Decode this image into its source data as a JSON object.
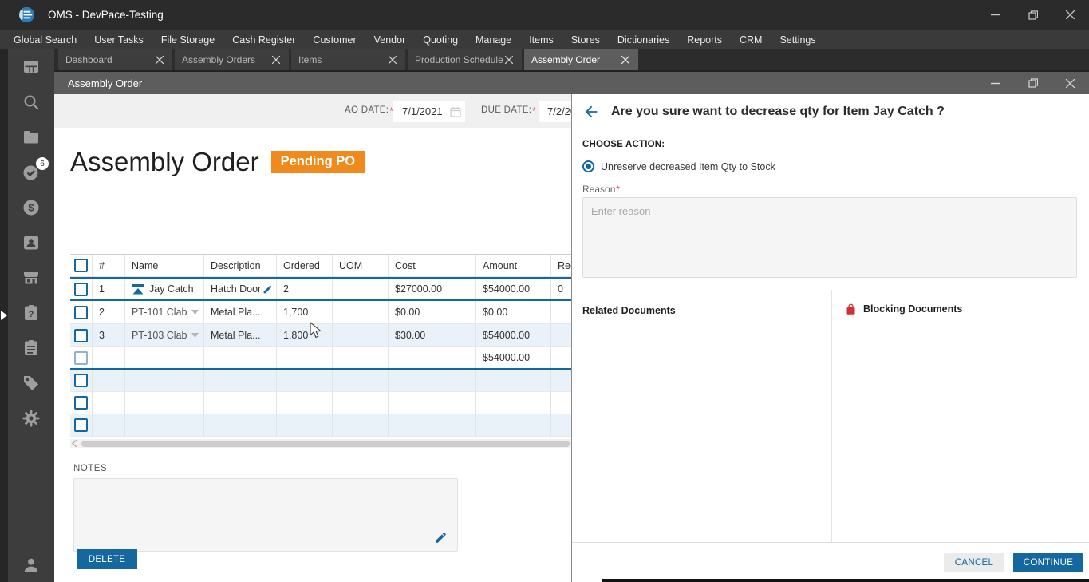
{
  "app": {
    "title": "OMS - DevPace-Testing"
  },
  "menu": {
    "items": [
      "Global Search",
      "User Tasks",
      "File Storage",
      "Cash Register",
      "Customer",
      "Vendor",
      "Quoting",
      "Manage",
      "Items",
      "Stores",
      "Dictionaries",
      "Reports",
      "CRM",
      "Settings"
    ]
  },
  "tabs": [
    {
      "label": "Dashboard"
    },
    {
      "label": "Assembly Orders"
    },
    {
      "label": "Items"
    },
    {
      "label": "Production Schedule"
    },
    {
      "label": "Assembly Order"
    }
  ],
  "sidebar": {
    "task_badge_count": "6"
  },
  "ao_window": {
    "window_title": "Assembly Order",
    "ao_date_label": "AO DATE:",
    "ao_date_value": "7/1/2021",
    "due_date_label": "DUE DATE:",
    "due_date_value": "7/2/20",
    "required_mark": "*",
    "heading": "Assembly Order",
    "status_badge": "Pending PO",
    "table": {
      "headers": {
        "num": "#",
        "name": "Name",
        "description": "Description",
        "ordered": "Ordered",
        "uom": "UOM",
        "cost": "Cost",
        "amount": "Amount",
        "received": "Rec"
      },
      "rows": [
        {
          "num": "1",
          "name": "Jay Catch",
          "description": "Hatch Door",
          "ordered": "2",
          "uom": "",
          "cost": "$27000.00",
          "amount": "$54000.00",
          "received": "0"
        },
        {
          "num": "2",
          "name": "PT-101 Clab",
          "description": "Metal Pla...",
          "ordered": "1,700",
          "uom": "",
          "cost": "$0.00",
          "amount": "$0.00",
          "received": ""
        },
        {
          "num": "3",
          "name": "PT-103 Clab",
          "description": "Metal Pla...",
          "ordered": "1,800",
          "uom": "",
          "cost": "$30.00",
          "amount": "$54000.00",
          "received": ""
        }
      ],
      "total_amount": "$54000.00"
    },
    "notes_label": "NOTES",
    "delete_button_label": "DELETE"
  },
  "dialog": {
    "title": "Are you sure want to decrease qty for Item Jay Catch ?",
    "choose_action_label": "CHOOSE ACTION:",
    "action_option": "Unreserve decreased Item Qty to Stock",
    "reason_label": "Reason",
    "required_mark": "*",
    "reason_placeholder": "Enter reason",
    "related_documents_title": "Related Documents",
    "blocking_documents_title": "Blocking Documents",
    "cancel_button_label": "CANCEL",
    "continue_button_label": "CONTINUE"
  },
  "colors": {
    "accent_blue": "#15689F",
    "badge_orange": "#F08A1D",
    "danger_red": "#D32F2F",
    "titlebar": "#2B2B2B"
  }
}
